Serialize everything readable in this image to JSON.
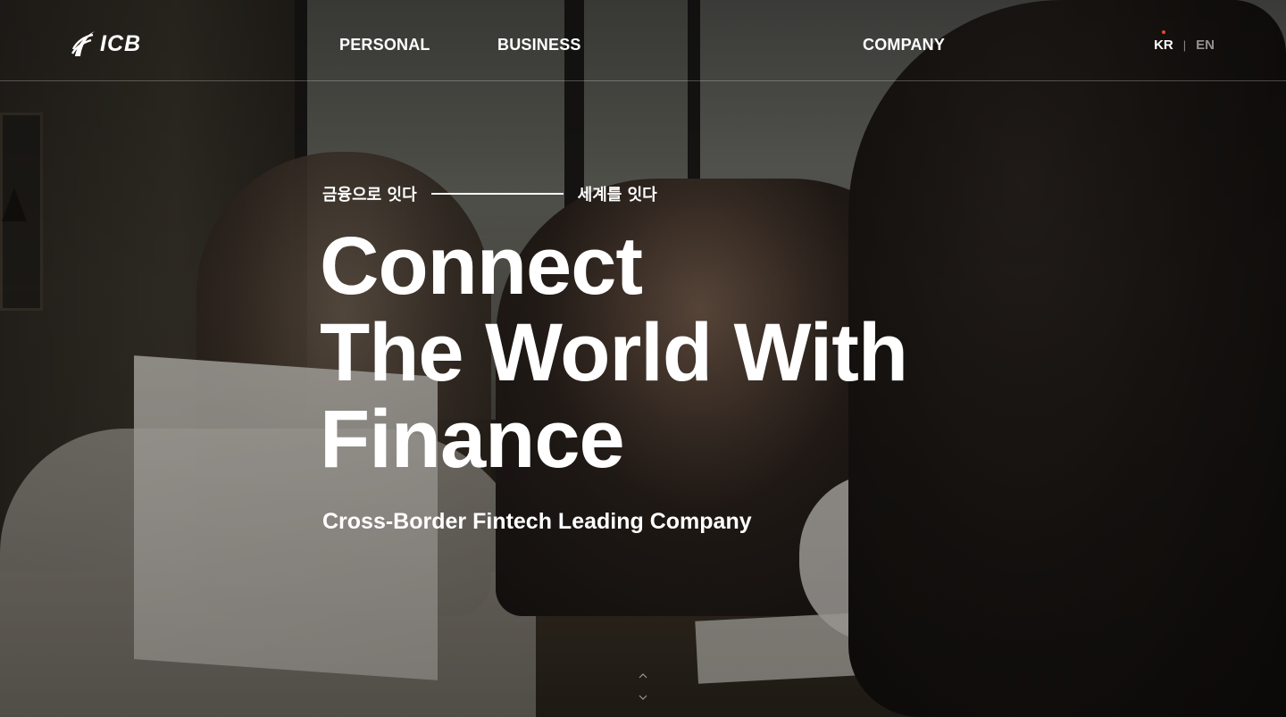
{
  "header": {
    "logo_text": "ICB",
    "nav": [
      {
        "label": "PERSONAL"
      },
      {
        "label": "BUSINESS"
      },
      {
        "label": "COMPANY"
      }
    ],
    "lang": {
      "active": "KR",
      "separator": "|",
      "inactive": "EN"
    }
  },
  "hero": {
    "tagline_left": "금융으로 잇다",
    "tagline_right": "세계를 잇다",
    "headline_lines": [
      "Connect",
      "The World With",
      "Finance"
    ],
    "subhead": "Cross-Border Fintech Leading Company"
  },
  "icons": {
    "logo": "icb-wing-logo-icon",
    "scroll": "chevron-up-down-icon",
    "active_lang_dot": "#e8482c"
  }
}
